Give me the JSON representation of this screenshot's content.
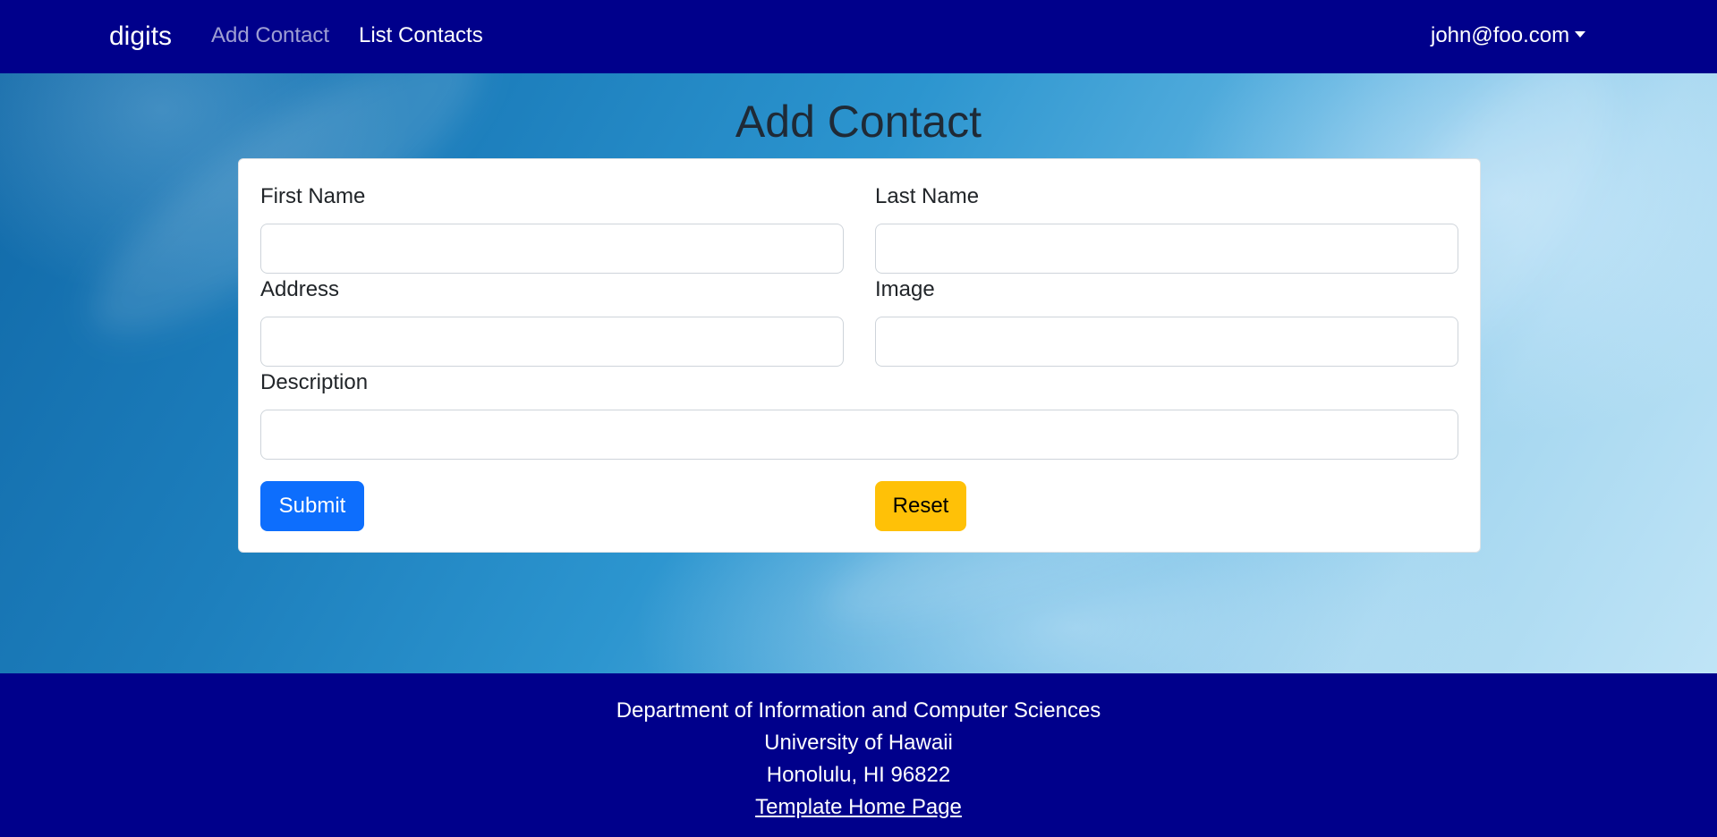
{
  "navbar": {
    "brand": "digits",
    "links": [
      {
        "label": "Add Contact",
        "active": true
      },
      {
        "label": "List Contacts",
        "active": false
      }
    ],
    "user": "john@foo.com",
    "background": "#00008b"
  },
  "page": {
    "title": "Add Contact"
  },
  "form": {
    "first_name": {
      "label": "First Name",
      "value": ""
    },
    "last_name": {
      "label": "Last Name",
      "value": ""
    },
    "address": {
      "label": "Address",
      "value": ""
    },
    "image": {
      "label": "Image",
      "value": ""
    },
    "description": {
      "label": "Description",
      "value": ""
    },
    "submit_label": "Submit",
    "reset_label": "Reset",
    "submit_color": "#0d6efd",
    "reset_color": "#ffc107"
  },
  "footer": {
    "lines": [
      "Department of Information and Computer Sciences",
      "University of Hawaii",
      "Honolulu, HI 96822"
    ],
    "link_label": "Template Home Page"
  },
  "icons": {
    "user_menu_caret": "chevron-down-icon"
  }
}
